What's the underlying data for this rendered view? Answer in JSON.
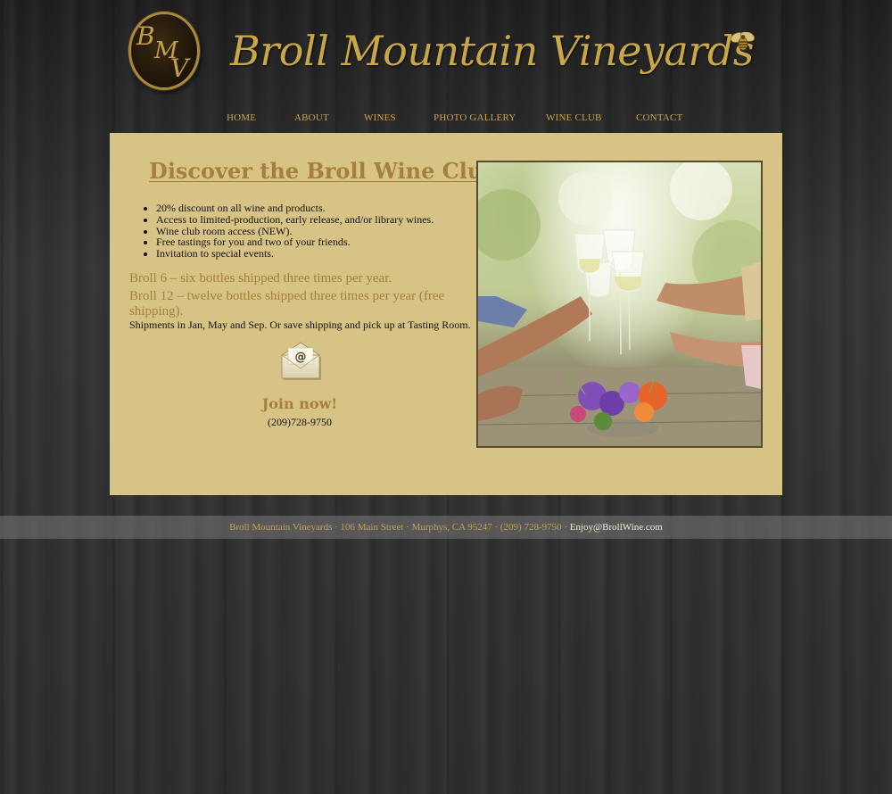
{
  "header": {
    "logo_letters": [
      "B",
      "M",
      "V"
    ],
    "title": "Broll Mountain Vineyards"
  },
  "nav": {
    "items": [
      {
        "label": "HOME"
      },
      {
        "label": "ABOUT"
      },
      {
        "label": "WINES"
      },
      {
        "label": "PHOTO GALLERY"
      },
      {
        "label": "WINE CLUB"
      },
      {
        "label": "CONTACT"
      }
    ]
  },
  "main": {
    "title": "Discover the Broll Wine Club",
    "benefits": [
      "20% discount on all wine and products.",
      "Access to limited-production, early release, and/or library wines.",
      "Wine club room access (NEW).",
      "Free tastings for you and two of your friends.",
      "Invitation to special events."
    ],
    "plans": [
      "Broll 6 – six bottles shipped three times per year.",
      "Broll 12 – twelve bottles shipped three times per year (free shipping)."
    ],
    "shipping_note": "Shipments in Jan, May and Sep.  Or save shipping and pick up at Tasting Room.",
    "join_label": "Join now!",
    "phone": "(209)728-9750",
    "email_icon_glyph": "@"
  },
  "footer": {
    "address": "Broll Mountain Vineyards · 106 Main Street · Murphys, CA 95247 · (209) 728-9750 · ",
    "email": "Enjoy@BrollWine.com"
  },
  "colors": {
    "gold": "#c9a746",
    "panel": "#d7c385",
    "accent_text": "#a4803c",
    "background": "#2b2b2b"
  }
}
